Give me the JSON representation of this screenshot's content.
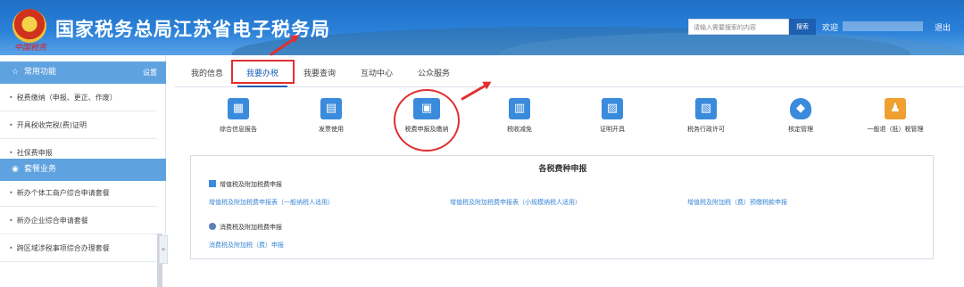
{
  "header": {
    "title": "国家税务总局江苏省电子税务局",
    "seal_text": "中国税务",
    "search_placeholder": "请输入需要搜索的内容",
    "search_button": "搜索",
    "welcome": "欢迎",
    "logout": "退出"
  },
  "sidebar": {
    "common": {
      "label": "常用功能",
      "settings": "设置",
      "icon": "star-icon"
    },
    "common_items": [
      "税费缴纳（申报、更正、作废）",
      "开具税收完税(费)证明",
      "社保费申报"
    ],
    "package": {
      "label": "套餐业务",
      "icon": "package-icon"
    },
    "package_items": [
      "新办个体工商户综合申请套餐",
      "新办企业综合申请套餐",
      "跨区域涉税事项综合办理套餐"
    ],
    "collapse": "«"
  },
  "tabs": [
    "我的信息",
    "我要办税",
    "我要查询",
    "互动中心",
    "公众服务"
  ],
  "active_tab": "我要办税",
  "functions": [
    {
      "label": "综合信息报告",
      "icon": "monitor-chart-icon"
    },
    {
      "label": "发票使用",
      "icon": "invoice-icon"
    },
    {
      "label": "税费申报及缴纳",
      "icon": "monitor-icon"
    },
    {
      "label": "税收减免",
      "icon": "chart-icon"
    },
    {
      "label": "证明开具",
      "icon": "certificate-icon"
    },
    {
      "label": "税务行政许可",
      "icon": "document-icon"
    },
    {
      "label": "核定管理",
      "icon": "shield-icon"
    },
    {
      "label": "一般退（抵）税管理",
      "icon": "people-icon"
    }
  ],
  "panel": {
    "title": "各税费种申报",
    "sections": [
      {
        "label": "增值税及附加税费申报",
        "links": [
          "增值税及附加税费申报表（一般纳税人适用）",
          "增值税及附加税费申报表（小规模纳税人适用）",
          "增值税及附加税（费）预缴税款申报"
        ]
      },
      {
        "label": "消费税及附加税费申报",
        "links": [
          "消费税及附加税（费）申报"
        ]
      }
    ]
  },
  "colors": {
    "brand": "#1f6fc6",
    "accent": "#1a5fb4",
    "highlight": "#e03030"
  }
}
